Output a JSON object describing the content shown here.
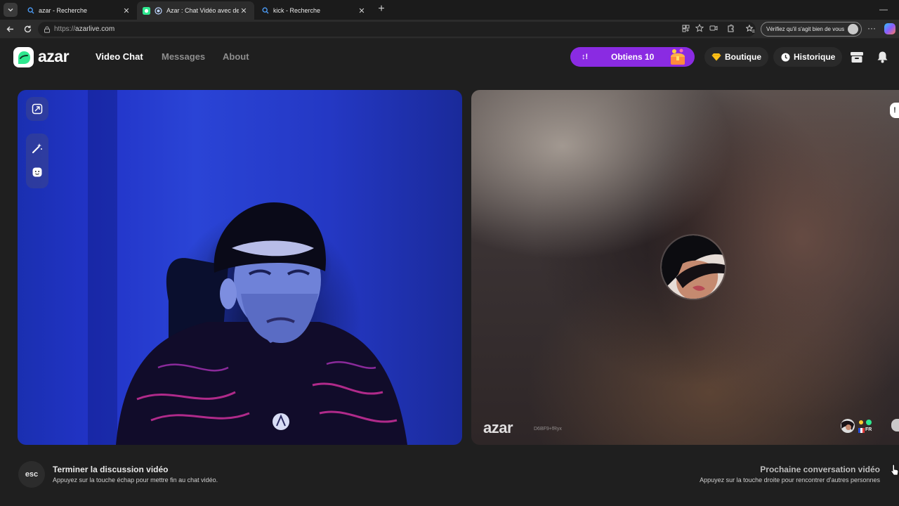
{
  "browser": {
    "tabs": [
      {
        "title": "azar - Recherche",
        "icon": "search-icon",
        "active": false
      },
      {
        "title": "Azar : Chat Vidéo avec de nou",
        "icon": "azar-favicon",
        "active": true
      },
      {
        "title": "kick - Recherche",
        "icon": "search-icon",
        "active": false
      }
    ],
    "close_glyph": "✕",
    "new_tab_glyph": "+",
    "url_scheme": "https://",
    "url_host": "azarlive.com",
    "verify_label": "Vérifiez qu'il s'agit bien de vous"
  },
  "header": {
    "logo": "azar",
    "nav": [
      "Video Chat",
      "Messages",
      "About"
    ],
    "promo_icon": "↕!",
    "promo_label": "Obtiens 10",
    "shop_label": "Boutique",
    "history_label": "Historique"
  },
  "partner": {
    "watermark": "azar",
    "user_id": "D6BF9+fRyx",
    "country": "FR"
  },
  "footer": {
    "esc_key": "esc",
    "end_title": "Terminer la discussion vidéo",
    "end_subtitle": "Appuyez sur la touche échap pour mettre fin au chat vidéo.",
    "next_title": "Prochaine conversation vidéo",
    "next_subtitle": "Appuyez sur la touche droite pour rencontrer d'autres personnes"
  },
  "colors": {
    "accent_purple": "#8a2be2",
    "brand_green": "#2ee88f",
    "background": "#1f1f1f"
  }
}
